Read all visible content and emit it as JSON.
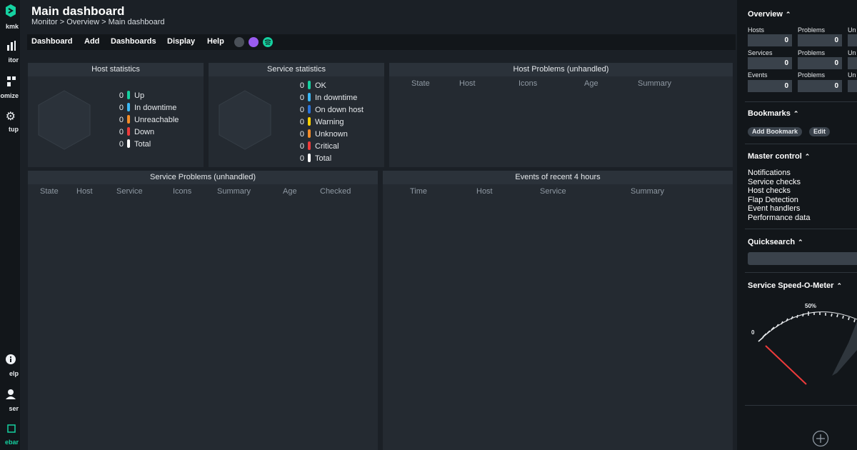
{
  "leftnav": {
    "items": [
      {
        "label": "kmk",
        "icon": "checkmk-logo-icon"
      },
      {
        "label": "itor",
        "icon": "monitor-icon"
      },
      {
        "label": "omize",
        "icon": "customize-icon"
      },
      {
        "label": "tup",
        "icon": "setup-gear-icon"
      },
      {
        "label": "elp",
        "icon": "help-icon"
      },
      {
        "label": "ser",
        "icon": "user-icon"
      },
      {
        "label": "ebar",
        "icon": "sidebar-icon"
      }
    ]
  },
  "header": {
    "title": "Main dashboard",
    "breadcrumb": "Monitor > Overview > Main dashboard"
  },
  "menu": {
    "items": [
      "Dashboard",
      "Add",
      "Dashboards",
      "Display",
      "Help"
    ]
  },
  "host_stats": {
    "title": "Host statistics",
    "rows": [
      {
        "count": "0",
        "label": "Up",
        "color": "#15d1a0"
      },
      {
        "count": "0",
        "label": "In downtime",
        "color": "#3bb7f4"
      },
      {
        "count": "0",
        "label": "Unreachable",
        "color": "#f28c28"
      },
      {
        "count": "0",
        "label": "Down",
        "color": "#ee3b3b"
      },
      {
        "count": "0",
        "label": "Total",
        "color": "#ffffff"
      }
    ]
  },
  "service_stats": {
    "title": "Service statistics",
    "rows": [
      {
        "count": "0",
        "label": "OK",
        "color": "#15d1a0"
      },
      {
        "count": "0",
        "label": "In downtime",
        "color": "#3bb7f4"
      },
      {
        "count": "0",
        "label": "On down host",
        "color": "#2a73d8"
      },
      {
        "count": "0",
        "label": "Warning",
        "color": "#ffd100"
      },
      {
        "count": "0",
        "label": "Unknown",
        "color": "#f28c28"
      },
      {
        "count": "0",
        "label": "Critical",
        "color": "#ee3b3b"
      },
      {
        "count": "0",
        "label": "Total",
        "color": "#ffffff"
      }
    ]
  },
  "host_problems": {
    "title": "Host Problems (unhandled)",
    "columns": [
      "State",
      "Host",
      "Icons",
      "Age",
      "Summary"
    ]
  },
  "service_problems": {
    "title": "Service Problems (unhandled)",
    "columns": [
      "State",
      "Host",
      "Service",
      "Icons",
      "Summary",
      "Age",
      "Checked"
    ]
  },
  "events": {
    "title": "Events of recent 4 hours",
    "columns": [
      "Time",
      "Host",
      "Service",
      "Summary"
    ]
  },
  "sidebar": {
    "overview": {
      "title": "Overview",
      "rows": [
        {
          "l1": "Hosts",
          "l2": "Problems",
          "l3": "Un",
          "v1": "0",
          "v2": "0"
        },
        {
          "l1": "Services",
          "l2": "Problems",
          "l3": "Un",
          "v1": "0",
          "v2": "0"
        },
        {
          "l1": "Events",
          "l2": "Problems",
          "l3": "Un",
          "v1": "0",
          "v2": "0"
        }
      ]
    },
    "bookmarks": {
      "title": "Bookmarks",
      "add_label": "Add Bookmark",
      "edit_label": "Edit"
    },
    "master_control": {
      "title": "Master control",
      "items": [
        "Notifications",
        "Service checks",
        "Host checks",
        "Flap Detection",
        "Event handlers",
        "Performance data"
      ]
    },
    "quicksearch": {
      "title": "Quicksearch"
    },
    "speedometer": {
      "title": "Service Speed-O-Meter",
      "label_zero": "0",
      "label_mid": "50%"
    }
  }
}
